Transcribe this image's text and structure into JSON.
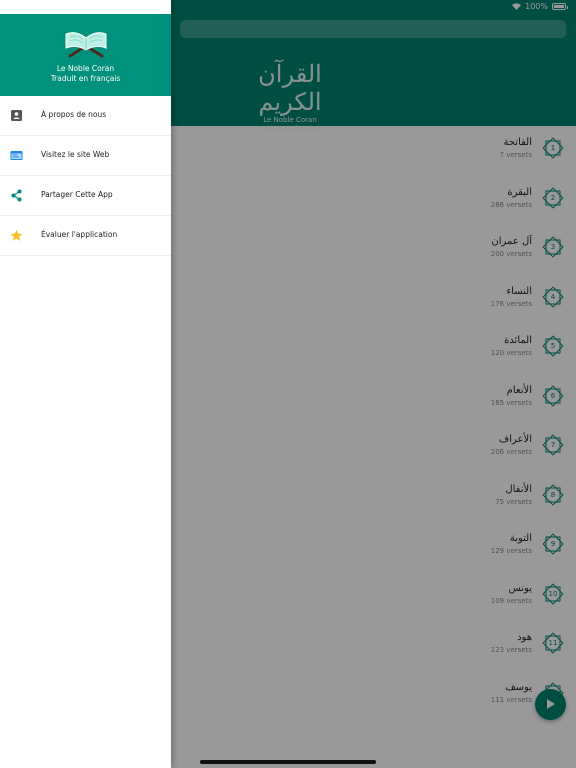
{
  "status_bar": {
    "battery": "100%",
    "battery_level": 1.0
  },
  "app_header": {
    "logo_calligraphy": "القرآن الكريم",
    "logo_line1": "Le Noble Coran",
    "logo_line2": "Traduit en français"
  },
  "surahs": [
    {
      "number": "1",
      "name": "الفاتحة",
      "verses": "7 versets"
    },
    {
      "number": "2",
      "name": "البقرة",
      "verses": "286 versets"
    },
    {
      "number": "3",
      "name": "آل عمران",
      "verses": "200 versets"
    },
    {
      "number": "4",
      "name": "النساء",
      "verses": "176 versets"
    },
    {
      "number": "5",
      "name": "المائدة",
      "verses": "120 versets"
    },
    {
      "number": "6",
      "name": "الأنعام",
      "verses": "165 versets"
    },
    {
      "number": "7",
      "name": "الأعراف",
      "verses": "206 versets"
    },
    {
      "number": "8",
      "name": "الأنفال",
      "verses": "75 versets"
    },
    {
      "number": "9",
      "name": "التوبة",
      "verses": "129 versets"
    },
    {
      "number": "10",
      "name": "يونس",
      "verses": "109 versets"
    },
    {
      "number": "11",
      "name": "هود",
      "verses": "123 versets"
    },
    {
      "number": "12",
      "name": "يوسف",
      "verses": "111 versets"
    }
  ],
  "drawer": {
    "title_line1": "Le Noble Coran",
    "title_line2": "Traduit en français",
    "items": [
      {
        "label": "À propos de nous",
        "icon": "contact-card-icon"
      },
      {
        "label": "Visitez le site Web",
        "icon": "web-browser-icon"
      },
      {
        "label": "Partager Cette App",
        "icon": "share-icon"
      },
      {
        "label": "Évaluer l'application",
        "icon": "star-icon"
      }
    ]
  },
  "colors": {
    "primary": "#00836f",
    "drawer_header": "#00917c",
    "icon_gray": "#555555",
    "icon_blue": "#1e88e5",
    "icon_teal": "#00897b",
    "icon_yellow": "#fbc02d"
  }
}
